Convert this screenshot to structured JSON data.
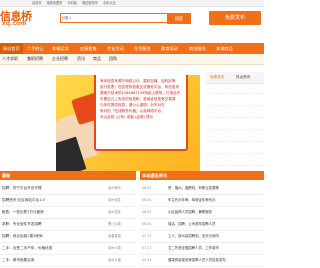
{
  "topbar": {
    "links": [
      "高首页",
      "搜狗收藏夹",
      "手机版",
      "微信服务号",
      "手机大全"
    ]
  },
  "logo": {
    "name": "信息桥",
    "domain": "xq.com"
  },
  "search": {
    "category": "分类",
    "placeholder": "",
    "button": "搜索"
  },
  "publish": {
    "label": "免费发布"
  },
  "nav": {
    "items": [
      "网站首页",
      "二手转让",
      "车辆买卖",
      "房屋租售",
      "交友活动",
      "生活服务",
      "教育培训",
      "商务服务",
      "本地商品"
    ]
  },
  "subnav": {
    "items": [
      "人才求职",
      "兼职招聘",
      "企业招聘",
      "资讯",
      "商品",
      "团购"
    ]
  },
  "banner": {
    "text": "有你信息来源于网络公众、高校自媒、百科民等自行发表，但仅提供信息交流服务平台。确认对信息的真实性负责，请保管好本公司提供的信息，提供正规的信息服务与商业推广，本网站信息真实有效！本站信息本法所引用内容版权归原作者（如有侵权）本站平台所有。",
    "text_lines": [
      "有你信息来源于网络公众、高校自媒、百科民等",
      "自行发表！但仅提供信息交流服务平台，有信息来",
      "源用于技术的1586667139特权上联系。打电话不",
      "不要自己上安全的信息和。查阅证信息有交易请",
      "与你在提供信息，请小心谨慎！对不对在",
      "有问的「在线服务价格」以及网络平台，",
      "本以此前 (公布) 或者 (此报) 提示"
    ]
  },
  "side": {
    "tabs": [
      "免费发布",
      "热点资讯"
    ]
  },
  "sections": {
    "left_title": "最新",
    "right_title": "本站通告资讯"
  },
  "left_list": [
    {
      "title": "招聘：苏宁平台开总代理",
      "meta": "泉州城市"
    },
    {
      "title": "招聘资讯·社区网站平台1.0",
      "meta": "泉州信息"
    },
    {
      "title": "租售：一枚出售7万元套房",
      "meta": "泉州信息"
    },
    {
      "title": "求职：专业软件开发招聘",
      "meta": "晋江乡镇"
    },
    {
      "title": "招聘：综合出租1楼3房间",
      "meta": "永春县镇"
    },
    {
      "title": "二手：出售二手汽车，价格优惠",
      "meta": "泉州乡镇"
    },
    {
      "title": "二手：城市房屋买卖",
      "meta": "泉州乡镇"
    }
  ],
  "right_list": [
    {
      "date": "06-01",
      "title": "贸：福州、福厦线，有职业发展等"
    },
    {
      "date": "06-01",
      "title": "车主代办年审、驾驶证年审代办"
    },
    {
      "date": "06-01",
      "title": "小区装修人员招聘，兼职服务"
    },
    {
      "date": "06-01",
      "title": "保洁、招聘，公司常年招聘人员"
    },
    {
      "date": "07-17",
      "title": "工人、泉州高招聘到，全天分钟内"
    },
    {
      "date": "07-17",
      "title": "艾二外语全国招聘人员，工作城市"
    },
    {
      "date": "05-11",
      "title": "健康的高保安家招聘人员人员信息发布"
    }
  ],
  "colors": {
    "accent": "#f0701a",
    "banner": "#ffc62e"
  }
}
